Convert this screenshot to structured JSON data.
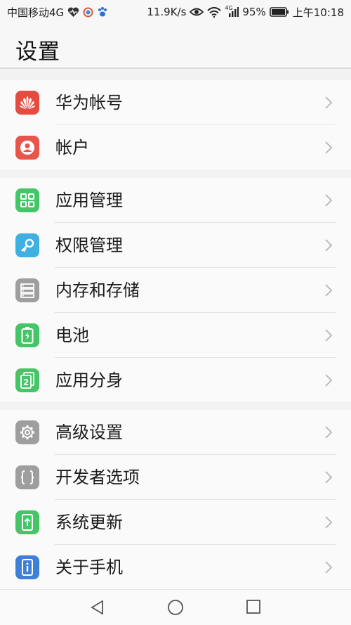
{
  "status_bar": {
    "carrier": "中国移动4G",
    "speed": "11.9K/s",
    "network_label": "4G",
    "battery": "95%",
    "time": "上午10:18"
  },
  "header": {
    "title": "设置"
  },
  "groups": [
    {
      "items": [
        {
          "label": "华为帐号",
          "icon": "huawei-logo-icon",
          "color": "#e64b40"
        },
        {
          "label": "帐户",
          "icon": "account-icon",
          "color": "#e8554b"
        }
      ]
    },
    {
      "items": [
        {
          "label": "应用管理",
          "icon": "apps-grid-icon",
          "color": "#45c468"
        },
        {
          "label": "权限管理",
          "icon": "key-icon",
          "color": "#3fb1e0"
        },
        {
          "label": "内存和存储",
          "icon": "storage-icon",
          "color": "#9e9e9e"
        },
        {
          "label": "电池",
          "icon": "battery-icon",
          "color": "#45c468"
        },
        {
          "label": "应用分身",
          "icon": "app-twin-icon",
          "color": "#45c468"
        }
      ]
    },
    {
      "items": [
        {
          "label": "高级设置",
          "icon": "gear-icon",
          "color": "#9e9e9e"
        },
        {
          "label": "开发者选项",
          "icon": "developer-braces-icon",
          "color": "#9e9e9e"
        },
        {
          "label": "系统更新",
          "icon": "system-update-icon",
          "color": "#45c468"
        },
        {
          "label": "关于手机",
          "icon": "info-icon",
          "color": "#3f7fd6"
        }
      ]
    }
  ],
  "nav_bar": {
    "back": "back-icon",
    "home": "home-icon",
    "recents": "recents-icon"
  }
}
